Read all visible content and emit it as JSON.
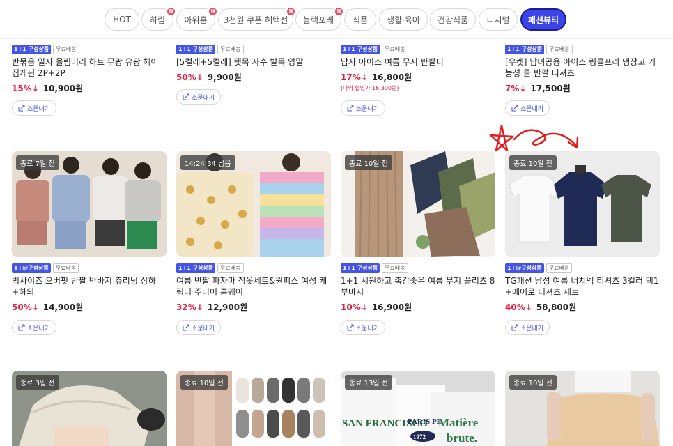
{
  "categories": [
    {
      "label": "HOT",
      "new": false,
      "active": false
    },
    {
      "label": "하림",
      "new": true,
      "active": false
    },
    {
      "label": "아워홈",
      "new": true,
      "active": false
    },
    {
      "label": "3천원 쿠폰 혜택전",
      "new": true,
      "active": false
    },
    {
      "label": "블랙포레",
      "new": true,
      "active": false
    },
    {
      "label": "식품",
      "new": false,
      "active": false
    },
    {
      "label": "생활·육아",
      "new": false,
      "active": false
    },
    {
      "label": "건강식품",
      "new": false,
      "active": false
    },
    {
      "label": "디지털",
      "new": false,
      "active": false
    },
    {
      "label": "패션뷰티",
      "new": false,
      "active": true
    }
  ],
  "new_badge": "N",
  "share_label": "소문내기",
  "tag_free": "무료배송",
  "row1": [
    {
      "tag": "1+1 구성상품",
      "title": "반묶음 일자 올림머리 하트 무광 유광 헤어 집게핀 2P+2P",
      "discount": "15%↓",
      "price": "10,900원"
    },
    {
      "tag": "1+1 구성상품",
      "title": "[5켤레+5켤레] 텟목 자수 발목 양말",
      "discount": "50%↓",
      "price": "9,900원"
    },
    {
      "tag": "1+1 구성상품",
      "title": "남자 아이스 여름 무지 반팔티",
      "discount": "17%↓",
      "price": "16,800원",
      "sub": "(나의 할인가 16,300원)"
    },
    {
      "tag": "1+1 구성상품",
      "title": "[우켓] 남녀공용 아이스 링클프리 냉장고 기능성 쿨 반팔 티셔츠",
      "discount": "7%↓",
      "price": "17,500원"
    }
  ],
  "row2": [
    {
      "timer": "종료 7일 전",
      "tag": "1+@구성상품",
      "title": "빅사이즈 오버핏 반팔 반바지 츄리닝 상하 +하의",
      "discount": "50%↓",
      "price": "14,900원"
    },
    {
      "timer": "14:24:34 남음",
      "tag": "1+1 구성상품",
      "title": "여름 반팔 파자마 잠옷세트&원피스 여성 캐릭터 주니어 홈웨어",
      "discount": "32%↓",
      "price": "12,900원"
    },
    {
      "timer": "종료 10일 전",
      "tag": "1+1 구성상품",
      "title": "1+1 시원하고 촉감좋은 여름 무지 플리츠 8부바지",
      "discount": "10%↓",
      "price": "16,900원"
    },
    {
      "timer": "종료 10일 전",
      "tag": "1+@구성상품",
      "title": "TG패션 남성 여름 너치넥 티셔츠 3컬러 택1 +에어로 티셔츠 세트",
      "discount": "40%↓",
      "price": "58,800원"
    }
  ],
  "row3": [
    {
      "timer": "종료 3일 전"
    },
    {
      "timer": "종료 10일 전"
    },
    {
      "timer": "종료 13일 전",
      "print1": "SAN FRANCISCO",
      "print2": "PARIS PE",
      "print3": "1972",
      "print4": "Matière",
      "print5": "brute."
    },
    {
      "timer": "종료 10일 전"
    }
  ],
  "colors": {
    "accent": "#3b44e8",
    "discount": "#e8193a",
    "new_badge": "#f04e5e",
    "annotation": "#e02020"
  }
}
